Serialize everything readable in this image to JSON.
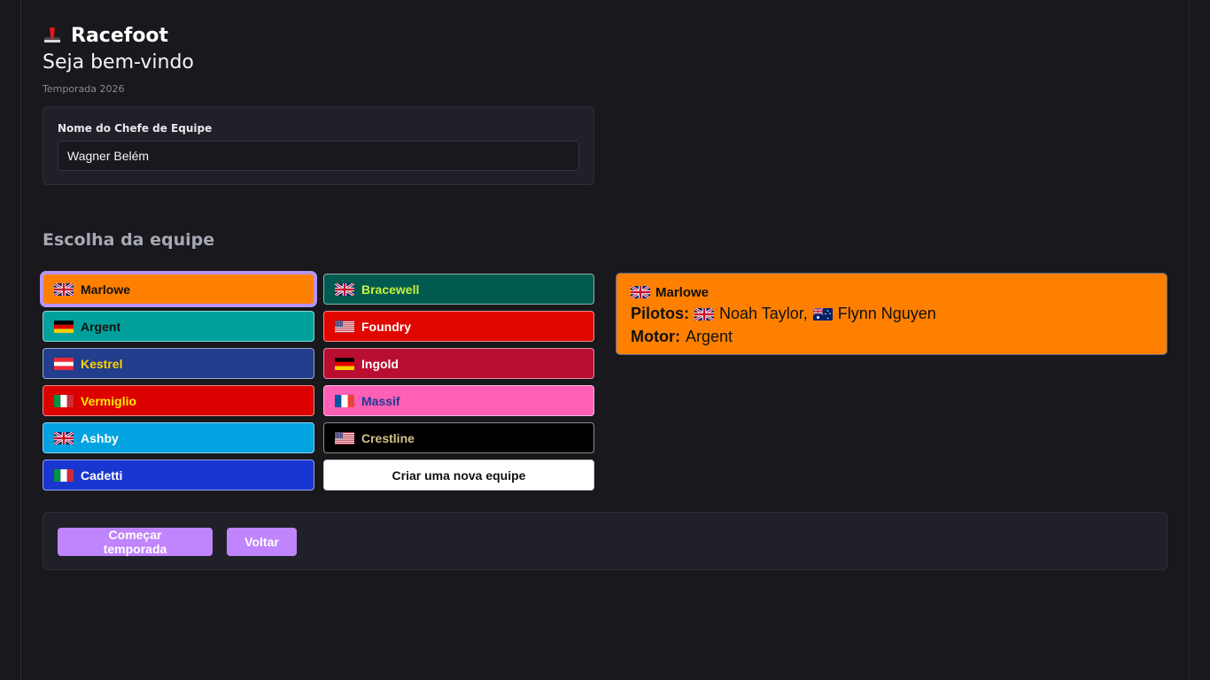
{
  "app": {
    "name": "Racefoot"
  },
  "header": {
    "welcome": "Seja bem-vindo",
    "season": "Temporada 2026"
  },
  "form": {
    "label": "Nome do Chefe de Equipe",
    "value": "Wagner Belém"
  },
  "team_section": {
    "title": "Escolha da equipe"
  },
  "teams": [
    {
      "name": "Marlowe",
      "flag": "uk",
      "bg": "#ff8000",
      "fg": "#111111",
      "selected": true
    },
    {
      "name": "Bracewell",
      "flag": "uk",
      "bg": "#005a4f",
      "fg": "#c8f03c"
    },
    {
      "name": "Argent",
      "flag": "de",
      "bg": "#00a19c",
      "fg": "#111111"
    },
    {
      "name": "Foundry",
      "flag": "us",
      "bg": "#e10600",
      "fg": "#ffffff"
    },
    {
      "name": "Kestrel",
      "flag": "at",
      "bg": "#223e8c",
      "fg": "#ffd200"
    },
    {
      "name": "Ingold",
      "flag": "de",
      "bg": "#b90d32",
      "fg": "#ffffff"
    },
    {
      "name": "Vermiglio",
      "flag": "it",
      "bg": "#dc0000",
      "fg": "#ffeb00"
    },
    {
      "name": "Massif",
      "flag": "fr",
      "bg": "#ff5fb4",
      "fg": "#1f3a93"
    },
    {
      "name": "Ashby",
      "flag": "uk",
      "bg": "#00a3e0",
      "fg": "#ffffff"
    },
    {
      "name": "Crestline",
      "flag": "us",
      "bg": "#000000",
      "fg": "#d8c08c"
    },
    {
      "name": "Cadetti",
      "flag": "it",
      "bg": "#1a36d0",
      "fg": "#ffffff"
    }
  ],
  "new_team": {
    "label": "Criar uma nova equipe"
  },
  "detail": {
    "team": "Marlowe",
    "team_flag": "uk",
    "drivers_label": "Pilotos:",
    "driver1": "Noah Taylor,",
    "driver1_flag": "uk",
    "driver2": "Flynn Nguyen",
    "driver2_flag": "au",
    "engine_label": "Motor:",
    "engine": "Argent",
    "bg": "#ff8000"
  },
  "actions": {
    "start_label": "Começar temporada",
    "back_label": "Voltar"
  },
  "colors": {
    "accent": "#c084fc",
    "background": "#18181d",
    "card": "#202028"
  }
}
